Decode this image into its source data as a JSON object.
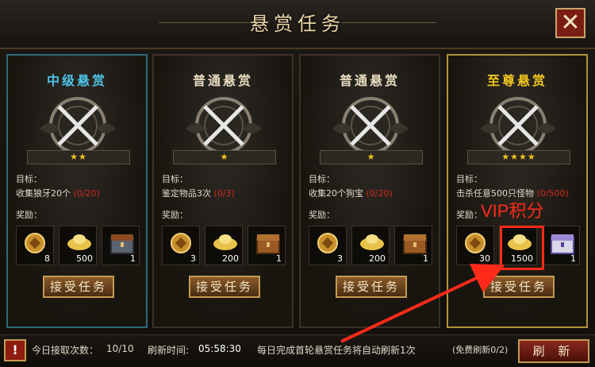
{
  "window": {
    "title": "悬赏任务",
    "close_icon": "✕"
  },
  "cards": [
    {
      "title": "中级悬赏",
      "title_color": "#4fc3e6",
      "stars": "★★",
      "target_label": "目标：",
      "task": "收集狼牙20个",
      "progress": "(0/20)",
      "reward_label": "奖励：",
      "rewards": [
        {
          "icon": "coin-icon",
          "qty": "8"
        },
        {
          "icon": "gold-ingot-icon",
          "qty": "500"
        },
        {
          "icon": "iron-chest-icon",
          "qty": "1"
        }
      ],
      "accept": "接受任务"
    },
    {
      "title": "普通悬赏",
      "title_color": "#e8dcc0",
      "stars": "★",
      "target_label": "目标：",
      "task": "鉴定物品3次",
      "progress": "(0/3)",
      "reward_label": "奖励：",
      "rewards": [
        {
          "icon": "coin-icon",
          "qty": "3"
        },
        {
          "icon": "gold-ingot-icon",
          "qty": "200"
        },
        {
          "icon": "wood-chest-icon",
          "qty": "1"
        }
      ],
      "accept": "接受任务"
    },
    {
      "title": "普通悬赏",
      "title_color": "#e8dcc0",
      "stars": "★",
      "target_label": "目标：",
      "task": "收集20个狗宝",
      "progress": "(0/20)",
      "reward_label": "奖励：",
      "rewards": [
        {
          "icon": "coin-icon",
          "qty": "3"
        },
        {
          "icon": "gold-ingot-icon",
          "qty": "200"
        },
        {
          "icon": "wood-chest-icon",
          "qty": "1"
        }
      ],
      "accept": "接受任务"
    },
    {
      "title": "至尊悬赏",
      "title_color": "#f2c81e",
      "stars": "★★★★",
      "target_label": "目标：",
      "task": "击杀任意500只怪物",
      "progress": "(0/500)",
      "reward_label": "奖励：",
      "rewards": [
        {
          "icon": "coin-icon",
          "qty": "30"
        },
        {
          "icon": "gold-ingot-icon",
          "qty": "1500"
        },
        {
          "icon": "silver-chest-icon",
          "qty": "1"
        }
      ],
      "accept": "接受任务"
    }
  ],
  "bottom": {
    "warn_icon": "!",
    "count_label": "今日接取次数：",
    "count_value": "10/10",
    "refresh_label": "刷新时间:",
    "refresh_time": "05:58:30",
    "notice": "每日完成首轮悬赏任务将自动刷新1次",
    "free_refresh": "(免费刷新0/2)",
    "refresh_button": "刷 新"
  },
  "annotation": {
    "label": "VIP积分"
  }
}
